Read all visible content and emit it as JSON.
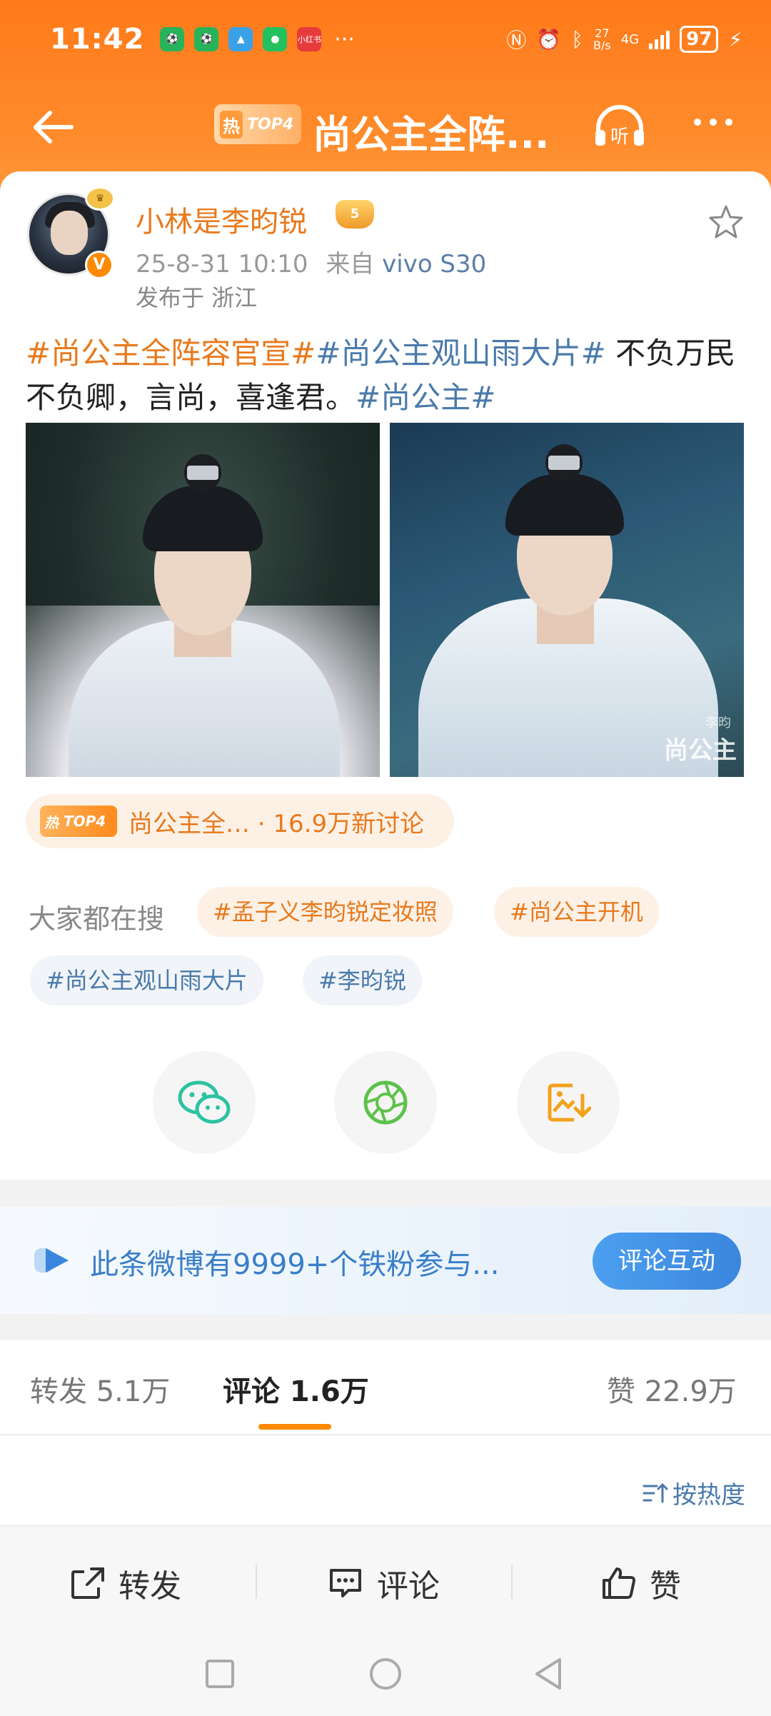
{
  "status_bar": {
    "time": "11:42",
    "apps": [
      {
        "icon": "app-sport-icon",
        "color": "#27b35a"
      },
      {
        "icon": "app-sport2-icon",
        "color": "#27b35a"
      },
      {
        "icon": "app-game-icon",
        "color": "#3aa0e8"
      },
      {
        "icon": "wechat-icon",
        "color": "#22c15e"
      },
      {
        "icon": "app-red-icon",
        "color": "#e83a3a",
        "label": "小红书"
      }
    ],
    "more": "···",
    "network_speed_value": "27",
    "network_speed_unit": "B/s",
    "network_type": "4G",
    "battery": "97"
  },
  "nav": {
    "hot_label": "热",
    "rank_label": "TOP4",
    "title": "尚公主全阵...",
    "listen_label": "听"
  },
  "post": {
    "user_name": "小林是李昀锐",
    "badge_label": "5",
    "time": "25-8-31 10:10",
    "source_prefix": "来自",
    "device": "vivo S30",
    "location": "发布于 浙江",
    "text_parts": {
      "tag1": "#尚公主全阵容官宣#",
      "tag2": "#尚公主观山雨大片#",
      "body": " 不负万民不负卿，言尚，喜逢君。",
      "tag3": "#尚公主#"
    },
    "photo_watermark": "尚公主",
    "photo_watermark_small": "李昀"
  },
  "topic_chip": {
    "hot_label": "热",
    "rank_label": "TOP4",
    "text": "尚公主全… · 16.9万新讨论"
  },
  "search": {
    "label": "大家都在搜",
    "tags": [
      "#孟子义李昀锐定妆照",
      "#尚公主开机",
      "#尚公主观山雨大片",
      "#李昀锐"
    ]
  },
  "share": {
    "icons": [
      "wechat-icon",
      "moments-icon",
      "save-image-icon"
    ]
  },
  "fans_banner": {
    "text": "此条微博有9999+个铁粉参与...",
    "button": "评论互动"
  },
  "tabs": {
    "repost": "转发 5.1万",
    "comment": "评论 1.6万",
    "like": "赞 22.9万"
  },
  "sort": {
    "label": "按热度"
  },
  "actions": {
    "repost": "转发",
    "comment": "评论",
    "like": "赞"
  },
  "colors": {
    "accent": "#ff8a00",
    "link_blue": "#4a7aab",
    "topic_orange": "#e8791c"
  }
}
